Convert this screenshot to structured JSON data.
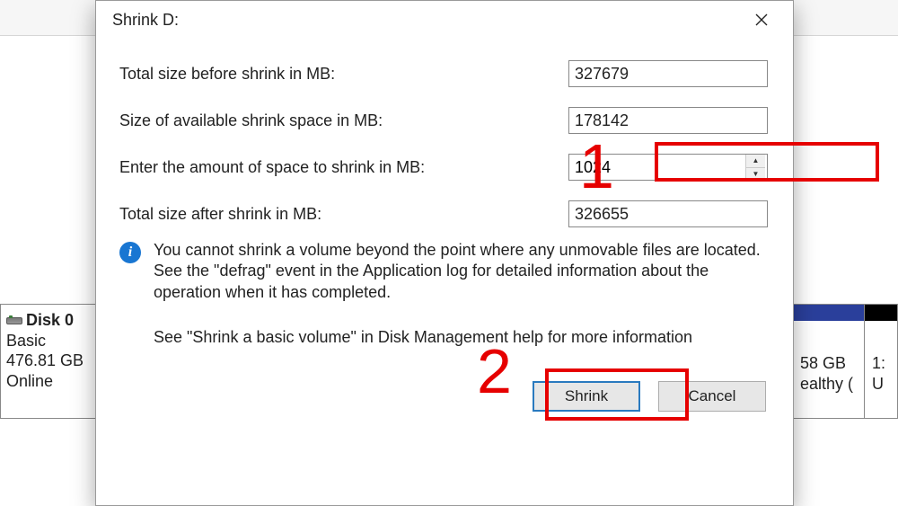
{
  "dialog": {
    "title": "Shrink D:",
    "rows": {
      "total_before_label": "Total size before shrink in MB:",
      "total_before_value": "327679",
      "avail_label": "Size of available shrink space in MB:",
      "avail_value": "178142",
      "enter_label": "Enter the amount of space to shrink in MB:",
      "enter_value": "1024",
      "total_after_label": "Total size after shrink in MB:",
      "total_after_value": "326655"
    },
    "info_text": "You cannot shrink a volume beyond the point where any unmovable files are located. See the \"defrag\" event in the Application log for detailed information about the operation when it has completed.",
    "help_text": "See \"Shrink a basic volume\" in Disk Management help for more information",
    "buttons": {
      "shrink": "Shrink",
      "cancel": "Cancel"
    }
  },
  "annotations": {
    "marker1": "1",
    "marker2": "2"
  },
  "background": {
    "disk_header": "Disk 0",
    "disk_type": "Basic",
    "disk_size": "476.81 GB",
    "disk_status": "Online",
    "part_size": "58 GB",
    "part_status": "ealthy (",
    "part2_a": "1:",
    "part2_b": "U"
  }
}
